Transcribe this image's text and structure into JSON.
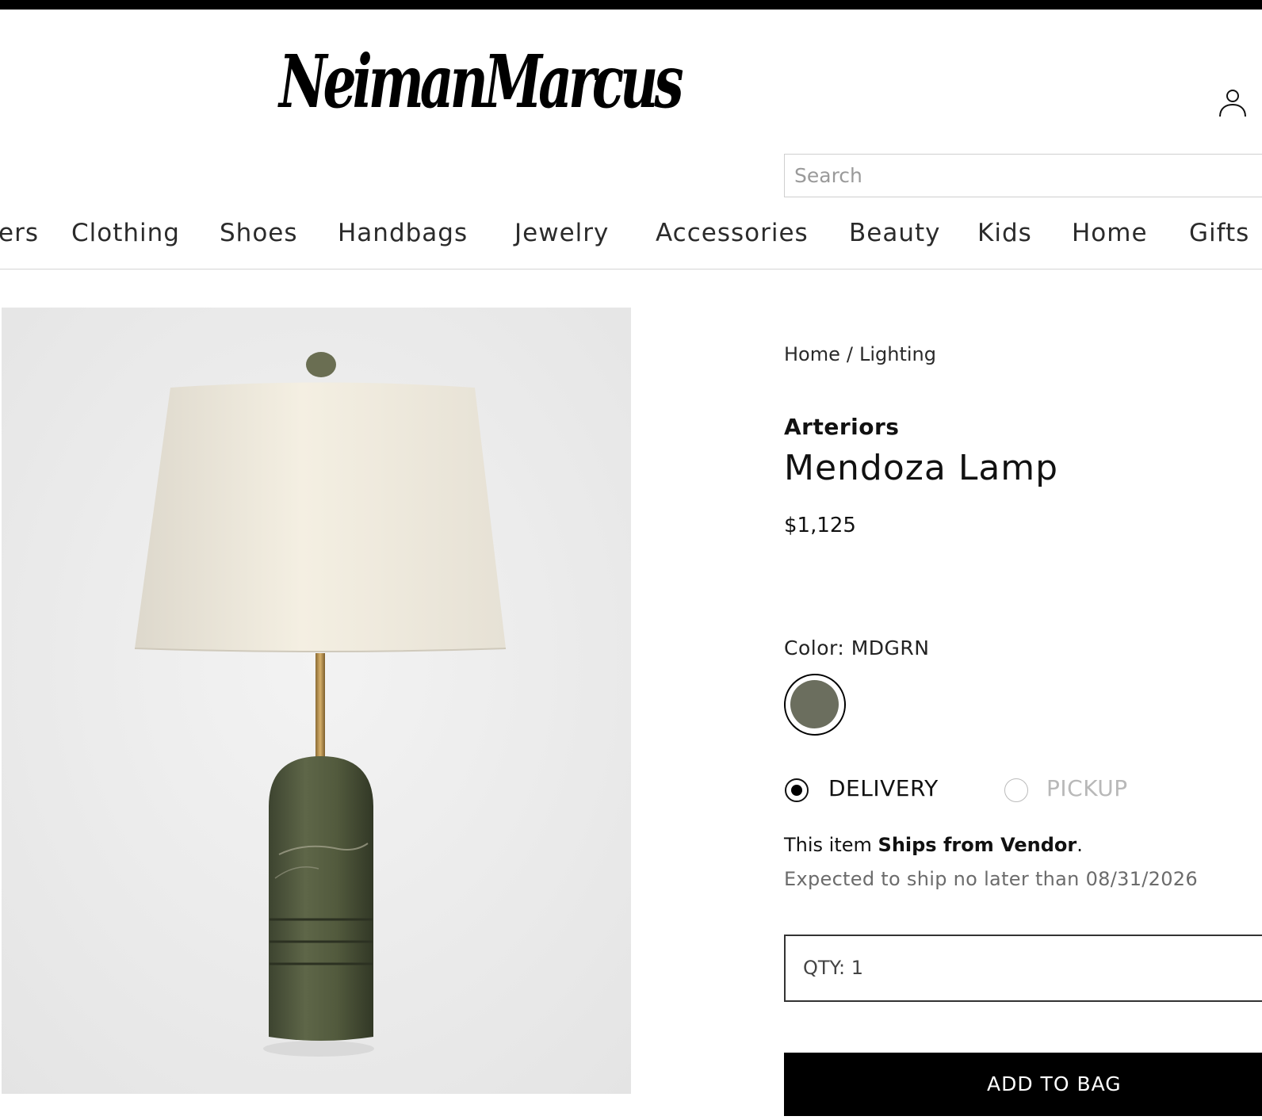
{
  "header": {
    "logo_text": "NeimanMarcus",
    "search_placeholder": "Search"
  },
  "nav": {
    "items": [
      "ers",
      "Clothing",
      "Shoes",
      "Handbags",
      "Jewelry",
      "Accessories",
      "Beauty",
      "Kids",
      "Home",
      "Gifts"
    ]
  },
  "breadcrumb": {
    "items": [
      "Home",
      "Lighting"
    ],
    "separator": "/"
  },
  "product": {
    "brand": "Arteriors",
    "title": "Mendoza Lamp",
    "price": "$1,125",
    "color_label": "Color: MDGRN",
    "swatch_color": "#6b6e5e",
    "image_alt": "Mendoza Lamp with white drum shade, brass stem and green marble base"
  },
  "fulfillment": {
    "delivery_label": "DELIVERY",
    "pickup_label": "PICKUP",
    "selected": "delivery",
    "ship_prefix": "This item ",
    "ship_strong": "Ships from Vendor",
    "ship_suffix": ".",
    "expected": "Expected to ship no later than 08/31/2026"
  },
  "quantity": {
    "label": "QTY: 1"
  },
  "actions": {
    "add_to_bag": "ADD TO BAG"
  },
  "icons": {
    "account": "account-icon"
  }
}
